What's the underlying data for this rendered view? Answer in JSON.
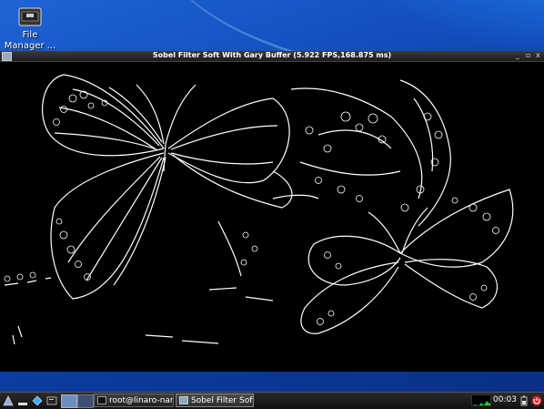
{
  "desktop": {
    "icons": [
      {
        "label": "File Manager ...",
        "icon": "file-manager-icon"
      }
    ]
  },
  "window": {
    "title": "Sobel Filter Soft With Gary Buffer (5.922 FPS,168.875 ms)",
    "controls": {
      "minimize": "_",
      "maximize": "▫",
      "close": "x"
    }
  },
  "taskbar": {
    "launchers": [
      "start-menu-icon",
      "minimize-all-icon",
      "file-manager-icon",
      "terminal-icon",
      "workspace-1-icon",
      "workspace-2-icon"
    ],
    "tasks": [
      {
        "label": "root@linaro-nan...",
        "icon": "terminal-icon",
        "active": false
      },
      {
        "label": "Sobel Filter Soft ...",
        "icon": "window-icon",
        "active": true
      }
    ],
    "clock": "00:03",
    "tray": [
      "cpu-monitor-icon",
      "battery-icon",
      "logout-icon"
    ]
  }
}
